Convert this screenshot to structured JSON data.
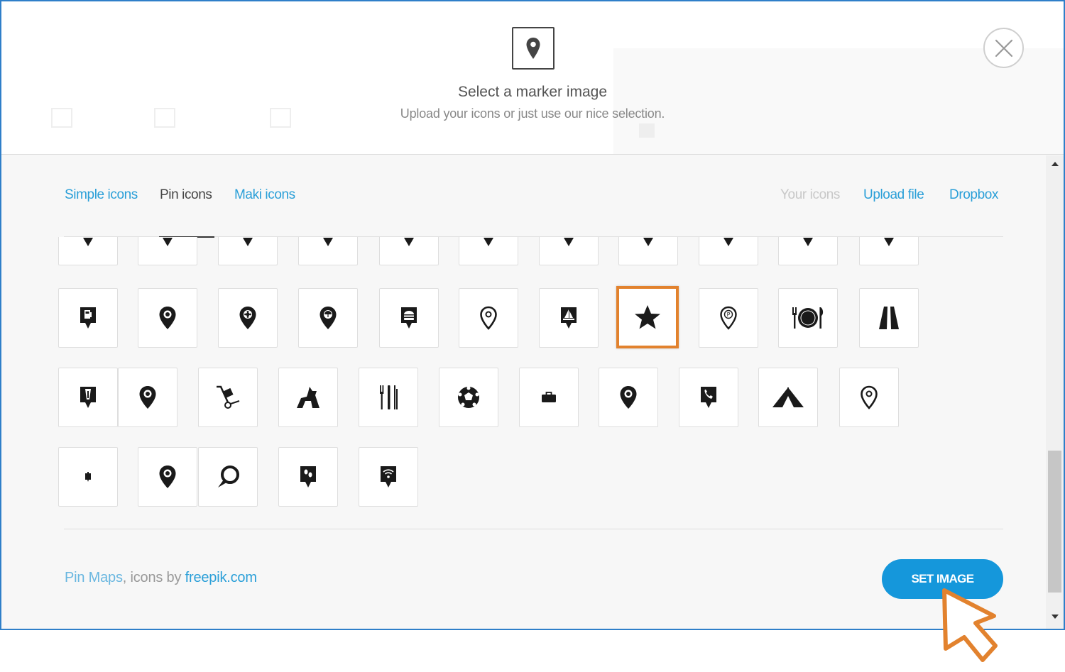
{
  "header": {
    "title": "Select a marker image",
    "subtitle": "Upload your icons or just use our nice selection.",
    "marker_icon": "map-pin-icon",
    "close_icon": "close-icon"
  },
  "tabs": {
    "left": [
      {
        "label": "Simple icons",
        "state": "link"
      },
      {
        "label": "Pin icons",
        "state": "active"
      },
      {
        "label": "Maki icons",
        "state": "link"
      }
    ],
    "right": [
      {
        "label": "Your icons",
        "state": "disabled"
      },
      {
        "label": "Upload file",
        "state": "link"
      },
      {
        "label": "Dropbox",
        "state": "link"
      }
    ]
  },
  "icon_grid": {
    "rows": [
      [
        "pin-partial-icon",
        "pin-partial-icon",
        "pin-partial-icon",
        "pin-partial-icon",
        "pin-partial-icon",
        "pin-partial-icon",
        "pin-partial-icon",
        "pin-partial-icon",
        "pin-partial-icon",
        "pin-partial-icon",
        "pin-partial-icon"
      ],
      [
        "gas-pin-icon",
        "pin-icon",
        "flower-pin-icon",
        "umbrella-pin-icon",
        "burger-pin-icon",
        "pin-outline-icon",
        "sailboat-pin-icon",
        "star-icon",
        "parking-pin-icon",
        "restaurant-icon",
        "road-icon"
      ],
      [
        "tower-pin-icon",
        "pin-icon",
        "hand-truck-icon",
        "dog-icon",
        "cutlery-icon",
        "soccer-ball-icon",
        "briefcase-icon",
        "pin-icon",
        "phone-pin-icon",
        "tent-icon",
        "pin-outline-icon"
      ],
      [
        "small-pin-icon",
        "pin-icon",
        "chat-bubble-icon",
        "foot-pin-icon",
        "wifi-pin-icon"
      ]
    ],
    "selected": "star-icon"
  },
  "footer": {
    "attribution_part1": "Pin Maps",
    "attribution_part2": ", icons by ",
    "attribution_part3": "freepik.com",
    "button_label": "SET IMAGE"
  },
  "colors": {
    "accent": "#1597db",
    "link": "#2a9fd8",
    "selection": "#e2822e",
    "frame": "#2f7fc9"
  }
}
